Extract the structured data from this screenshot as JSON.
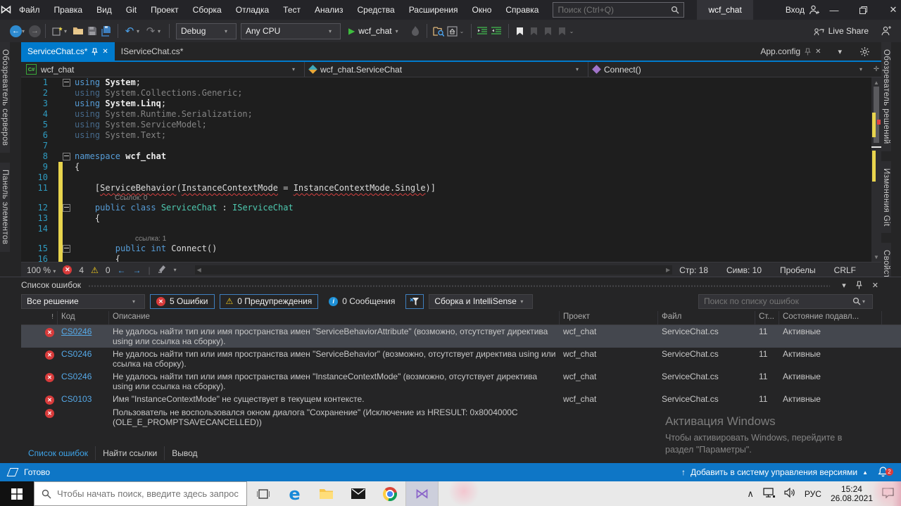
{
  "window": {
    "title_chip": "wcf_chat"
  },
  "titlebar": {
    "menus": [
      "Файл",
      "Правка",
      "Вид",
      "Git",
      "Проект",
      "Сборка",
      "Отладка",
      "Тест",
      "Анализ",
      "Средства",
      "Расширения",
      "Окно",
      "Справка"
    ],
    "search_placeholder": "Поиск (Ctrl+Q)",
    "signin": "Вход"
  },
  "toolbar": {
    "config": "Debug",
    "platform": "Any CPU",
    "startup": "wcf_chat",
    "live_share": "Live Share"
  },
  "strips": {
    "left": [
      "Обозреватель серверов",
      "Панель элементов"
    ],
    "right": [
      "Обозреватель решений",
      "Изменения Git",
      "Свойства"
    ]
  },
  "tabs": {
    "group_left": [
      {
        "label": "ServiceChat.cs*",
        "active": true
      },
      {
        "label": "IServiceChat.cs*",
        "active": false
      }
    ],
    "group_right": [
      {
        "label": "App.config",
        "active": false
      }
    ]
  },
  "navbar": {
    "project": "wcf_chat",
    "type": "wcf_chat.ServiceChat",
    "member": "Connect()"
  },
  "editor": {
    "rows": [
      {
        "kind": "code",
        "n": "1",
        "fold": true,
        "segs": [
          [
            "using ",
            "k"
          ],
          [
            "System",
            "wb"
          ],
          [
            ";",
            "w"
          ]
        ]
      },
      {
        "kind": "code",
        "n": "2",
        "segs": [
          [
            "using ",
            "dk"
          ],
          [
            "System.Collections.Generic;",
            "d"
          ]
        ]
      },
      {
        "kind": "code",
        "n": "3",
        "segs": [
          [
            "using ",
            "k"
          ],
          [
            "System.Linq",
            "wb"
          ],
          [
            ";",
            "w"
          ]
        ]
      },
      {
        "kind": "code",
        "n": "4",
        "segs": [
          [
            "using ",
            "dk"
          ],
          [
            "System.Runtime.Serialization;",
            "d"
          ]
        ]
      },
      {
        "kind": "code",
        "n": "5",
        "segs": [
          [
            "using ",
            "dk"
          ],
          [
            "System.ServiceModel;",
            "d"
          ]
        ]
      },
      {
        "kind": "code",
        "n": "6",
        "segs": [
          [
            "using ",
            "dk"
          ],
          [
            "System.Text;",
            "d"
          ]
        ]
      },
      {
        "kind": "code",
        "n": "7",
        "segs": []
      },
      {
        "kind": "code",
        "n": "8",
        "fold": true,
        "segs": [
          [
            "namespace ",
            "k"
          ],
          [
            "wcf_chat",
            "wb"
          ]
        ]
      },
      {
        "kind": "code",
        "n": "9",
        "segs": [
          [
            "{",
            "w"
          ]
        ]
      },
      {
        "kind": "code",
        "n": "10",
        "segs": []
      },
      {
        "kind": "code",
        "n": "11",
        "segs": [
          [
            "    [",
            "w"
          ],
          [
            "ServiceBehavior",
            "sq"
          ],
          [
            "(",
            "w"
          ],
          [
            "InstanceContextMode",
            "sq"
          ],
          [
            " = ",
            "w"
          ],
          [
            "InstanceContextMode.Single",
            "sq"
          ],
          [
            ")]",
            "w"
          ]
        ]
      },
      {
        "kind": "lens",
        "text": "Ссылок: 0",
        "ind": 33
      },
      {
        "kind": "code",
        "n": "12",
        "fold": true,
        "segs": [
          [
            "    ",
            "w"
          ],
          [
            "public class ",
            "k"
          ],
          [
            "ServiceChat",
            "t"
          ],
          [
            " : ",
            "w"
          ],
          [
            "IServiceChat",
            "t"
          ]
        ]
      },
      {
        "kind": "code",
        "n": "13",
        "segs": [
          [
            "    {",
            "w"
          ]
        ]
      },
      {
        "kind": "code",
        "n": "14",
        "segs": []
      },
      {
        "kind": "lens",
        "text": "ссылка: 1",
        "ind": 62
      },
      {
        "kind": "code",
        "n": "15",
        "fold": true,
        "segs": [
          [
            "        ",
            "w"
          ],
          [
            "public int ",
            "k"
          ],
          [
            "Connect()",
            "w"
          ]
        ]
      },
      {
        "kind": "code",
        "n": "16",
        "segs": [
          [
            "        {",
            "w"
          ]
        ]
      }
    ],
    "status": {
      "zoom": "100 %",
      "errors": "4",
      "warnings": "0",
      "line": "Стр: 18",
      "col": "Симв: 10",
      "spaces": "Пробелы",
      "eol": "CRLF"
    }
  },
  "error_panel": {
    "title": "Список ошибок",
    "scope": "Все решение",
    "errors_btn": "5 Ошибки",
    "warnings_btn": "0 Предупреждения",
    "messages_btn": "0 Сообщения",
    "filter_dropdown": "Сборка и IntelliSense",
    "search_placeholder": "Поиск по списку ошибок",
    "columns": [
      "Код",
      "Описание",
      "Проект",
      "Файл",
      "Ст...",
      "Состояние подавл..."
    ],
    "rows": [
      {
        "code": "CS0246",
        "link": true,
        "selected": true,
        "desc": "Не удалось найти тип или имя пространства имен \"ServiceBehaviorAttribute\" (возможно, отсутствует директива using или ссылка на сборку).",
        "project": "wcf_chat",
        "file": "ServiceChat.cs",
        "line": "11",
        "state": "Активные"
      },
      {
        "code": "CS0246",
        "desc": "Не удалось найти тип или имя пространства имен \"ServiceBehavior\" (возможно, отсутствует директива using или ссылка на сборку).",
        "project": "wcf_chat",
        "file": "ServiceChat.cs",
        "line": "11",
        "state": "Активные"
      },
      {
        "code": "CS0246",
        "desc": "Не удалось найти тип или имя пространства имен \"InstanceContextMode\" (возможно, отсутствует директива using или ссылка на сборку).",
        "project": "wcf_chat",
        "file": "ServiceChat.cs",
        "line": "11",
        "state": "Активные"
      },
      {
        "code": "CS0103",
        "desc": "Имя \"InstanceContextMode\" не существует в текущем контексте.",
        "project": "wcf_chat",
        "file": "ServiceChat.cs",
        "line": "11",
        "state": "Активные"
      },
      {
        "code": "",
        "desc": "Пользователь не воспользовался окном диалога \"Сохранение\" (Исключение из HRESULT: 0x8004000C (OLE_E_PROMPTSAVECANCELLED))",
        "project": "",
        "file": "",
        "line": "",
        "state": ""
      }
    ],
    "bottom_tabs": [
      {
        "label": "Список ошибок",
        "active": true
      },
      {
        "label": "Найти ссылки",
        "active": false
      },
      {
        "label": "Вывод",
        "active": false
      }
    ]
  },
  "statusbar": {
    "ready": "Готово",
    "vcs": "Добавить в систему управления версиями",
    "notifications": "2"
  },
  "watermark": {
    "line1": "Активация Windows",
    "line2": "Чтобы активировать Windows, перейдите в",
    "line3": "раздел \"Параметры\"."
  },
  "taskbar": {
    "search_placeholder": "Чтобы начать поиск, введите здесь запрос",
    "lang": "РУС",
    "time": "15:24",
    "date": "26.08.2021"
  }
}
